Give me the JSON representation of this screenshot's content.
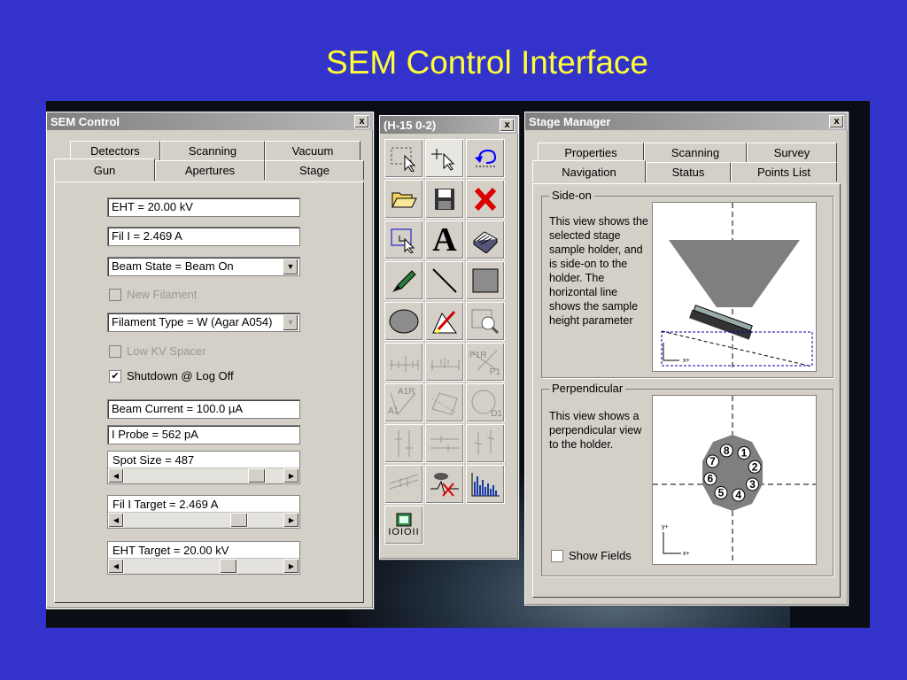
{
  "slide": {
    "title": "SEM Control Interface"
  },
  "sem_control": {
    "title": "SEM Control",
    "close": "x",
    "tabs_row1": [
      "Detectors",
      "Scanning",
      "Vacuum"
    ],
    "tabs_row2": [
      "Gun",
      "Apertures",
      "Stage"
    ],
    "eht": "EHT = 20.00 kV",
    "fil_i": "Fil I =  2.469 A",
    "beam_state": "Beam State = Beam On",
    "new_filament": "New Filament",
    "filament_type": "Filament Type = W (Agar A054)",
    "low_kv": "Low KV Spacer",
    "shutdown": "Shutdown @ Log Off",
    "beam_current": "Beam Current =  100.0 µA",
    "i_probe": "I Probe =    562 pA",
    "spot_size": "Spot Size = 487",
    "fil_target": "Fil I Target =  2.469 A",
    "eht_target": "EHT Target = 20.00 kV"
  },
  "toolbox": {
    "title": "(H-15 0-2)",
    "close": "x",
    "tools": [
      "select-region-icon",
      "crosshair-icon",
      "undo-icon",
      "open-folder-icon",
      "save-disk-icon",
      "delete-x-icon",
      "zoom-rect-icon",
      "text-A-icon",
      "book-icon",
      "pen-icon",
      "line-icon",
      "rectangle-icon",
      "ellipse-icon",
      "measure-icon",
      "magnify-icon",
      "scale-bar-icon",
      "scale-bar2-icon",
      "angle-icon",
      "angle2-icon",
      "polygon-icon",
      "circle-icon",
      "vertical-measure-icon",
      "horizontal-measure-icon",
      "cross-measure-icon",
      "diagonal-measure-icon",
      "spectrum-icon",
      "histogram-icon",
      "binary-image-icon"
    ],
    "binary_label": "IOIOII",
    "a_label": "A",
    "p_label1": "P1R",
    "p_label2": "P1",
    "a_label1": "A1R",
    "a_label2": "A1",
    "d_label": "D1"
  },
  "stage_manager": {
    "title": "Stage Manager",
    "close": "x",
    "tabs_row1": [
      "Properties",
      "Scanning",
      "Survey"
    ],
    "tabs_row2": [
      "Navigation",
      "Status",
      "Points List"
    ],
    "side_on_label": "Side-on",
    "side_on_text": "This view shows the selected stage sample holder, and is side-on to the holder. The horizontal line shows the sample height parameter",
    "perp_label": "Perpendicular",
    "perp_text": "This view shows a perpendicular view to the holder.",
    "show_fields": "Show Fields",
    "axis_y": "y+",
    "axis_x": "x+",
    "holder_numbers": [
      "1",
      "2",
      "3",
      "4",
      "5",
      "6",
      "7",
      "8"
    ]
  }
}
